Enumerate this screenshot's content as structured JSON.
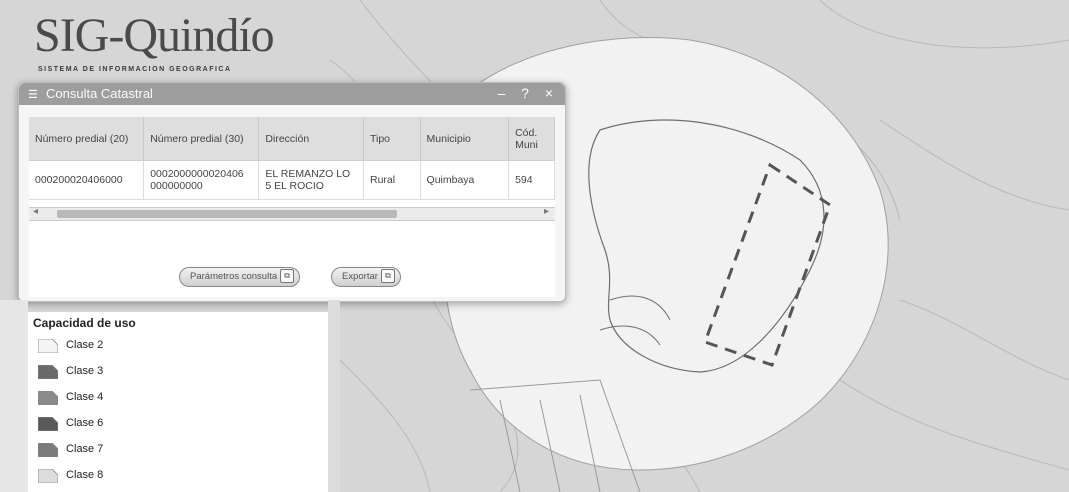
{
  "app": {
    "logo_title": "SIG-Quindío",
    "logo_subtitle": "SISTEMA DE INFORMACION GEOGRAFICA"
  },
  "dialog": {
    "title": "Consulta Catastral",
    "controls": "– ? ×",
    "columns": [
      "Número predial (20)",
      "Número predial (30)",
      "Dirección",
      "Tipo",
      "Municipio",
      "Cód. Muni"
    ],
    "rows": [
      [
        "000200020406000",
        "0002000000020406 000000000",
        "EL REMANZO LO 5 EL ROCIO",
        "Rural",
        "Quimbaya",
        "594"
      ]
    ],
    "buttons": {
      "params_label": "Parámetros consulta",
      "export_label": "Exportar"
    }
  },
  "legend": {
    "title": "Capacidad de uso",
    "items": [
      {
        "label": "Clase 2",
        "color": "#f4f4f4"
      },
      {
        "label": "Clase 3",
        "color": "#6a6a6a"
      },
      {
        "label": "Clase 4",
        "color": "#8a8a8a"
      },
      {
        "label": "Clase 6",
        "color": "#5a5a5a"
      },
      {
        "label": "Clase 7",
        "color": "#7a7a7a"
      },
      {
        "label": "Clase 8",
        "color": "#dcdcdc"
      }
    ]
  }
}
